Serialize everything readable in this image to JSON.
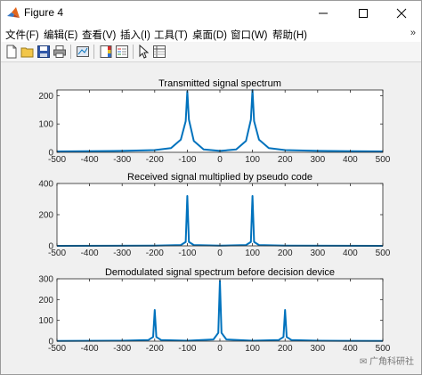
{
  "window": {
    "title": "Figure 4"
  },
  "menu": [
    {
      "id": "file",
      "label": "文件(F)"
    },
    {
      "id": "edit",
      "label": "编辑(E)"
    },
    {
      "id": "view",
      "label": "查看(V)"
    },
    {
      "id": "insert",
      "label": "插入(I)"
    },
    {
      "id": "tools",
      "label": "工具(T)"
    },
    {
      "id": "desktop",
      "label": "桌面(D)"
    },
    {
      "id": "window",
      "label": "窗口(W)"
    },
    {
      "id": "help",
      "label": "帮助(H)"
    }
  ],
  "toolbar": [
    "new-figure",
    "open",
    "save",
    "print",
    "link-plot",
    "insert-colorbar",
    "insert-legend",
    "pointer-edit",
    "property-inspector"
  ],
  "watermark": "广角科研社",
  "colors": {
    "line": "#0072bd",
    "axes": "#262626",
    "figure_bg": "#f0f0f0"
  },
  "chart_data": [
    {
      "type": "line",
      "title": "Transmitted signal spectrum",
      "xlim": [
        -500,
        500
      ],
      "ylim": [
        0,
        220
      ],
      "xticks": [
        -500,
        -400,
        -300,
        -200,
        -100,
        0,
        100,
        200,
        300,
        400,
        500
      ],
      "yticks": [
        0,
        100,
        200
      ],
      "series": [
        {
          "x": [
            -500,
            -400,
            -300,
            -200,
            -150,
            -120,
            -105,
            -100,
            -95,
            -80,
            -50,
            0,
            50,
            80,
            95,
            100,
            105,
            120,
            150,
            200,
            300,
            400,
            500
          ],
          "y": [
            3,
            4,
            5,
            8,
            15,
            45,
            110,
            215,
            115,
            40,
            10,
            5,
            10,
            40,
            115,
            220,
            110,
            45,
            15,
            8,
            5,
            4,
            3
          ]
        }
      ]
    },
    {
      "type": "line",
      "title": "Received signal multiplied by pseudo code",
      "xlim": [
        -500,
        500
      ],
      "ylim": [
        0,
        400
      ],
      "xticks": [
        -500,
        -400,
        -300,
        -200,
        -100,
        0,
        100,
        200,
        300,
        400,
        500
      ],
      "yticks": [
        0,
        200,
        400
      ],
      "series": [
        {
          "x": [
            -500,
            -200,
            -120,
            -105,
            -100,
            -95,
            -80,
            0,
            80,
            95,
            100,
            105,
            120,
            200,
            500
          ],
          "y": [
            0,
            1,
            5,
            25,
            320,
            25,
            5,
            1,
            5,
            25,
            320,
            25,
            5,
            1,
            0
          ]
        }
      ]
    },
    {
      "type": "line",
      "title": "Demodulated signal spectrum before decision device",
      "xlim": [
        -500,
        500
      ],
      "ylim": [
        0,
        300
      ],
      "xticks": [
        -500,
        -400,
        -300,
        -200,
        -100,
        0,
        100,
        200,
        300,
        400,
        500
      ],
      "yticks": [
        0,
        100,
        200,
        300
      ],
      "series": [
        {
          "x": [
            -500,
            -300,
            -220,
            -205,
            -200,
            -195,
            -180,
            -100,
            -20,
            -5,
            0,
            5,
            20,
            100,
            180,
            195,
            200,
            205,
            220,
            300,
            500
          ],
          "y": [
            1,
            2,
            5,
            20,
            150,
            20,
            5,
            2,
            8,
            40,
            290,
            40,
            8,
            2,
            5,
            20,
            150,
            20,
            5,
            2,
            1
          ]
        }
      ]
    }
  ]
}
